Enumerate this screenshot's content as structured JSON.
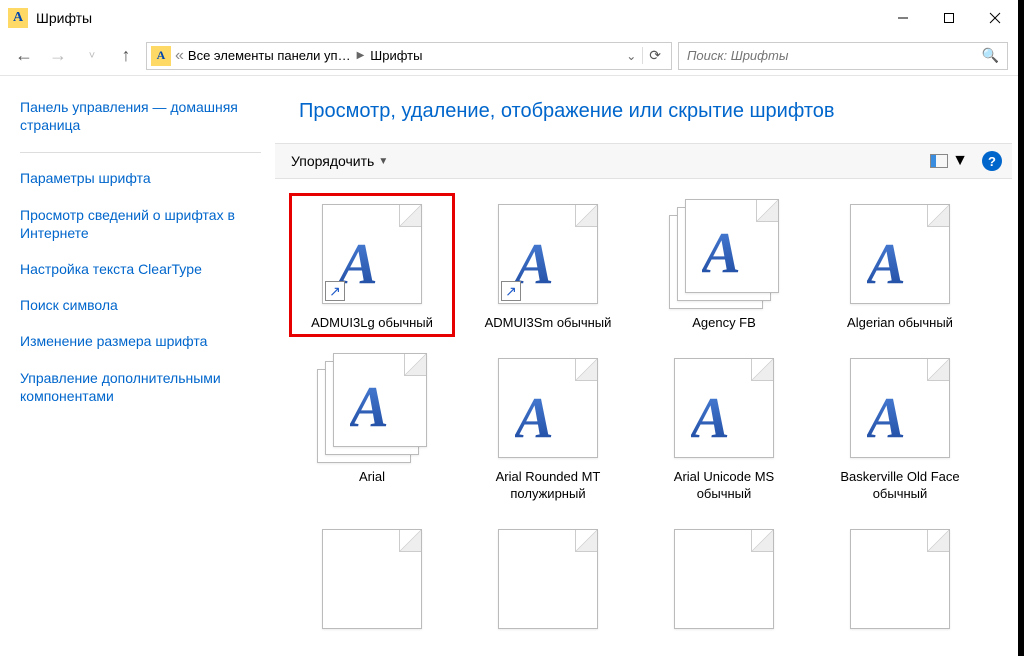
{
  "window": {
    "title": "Шрифты"
  },
  "address": {
    "seg1": "Все элементы панели уп…",
    "seg2": "Шрифты"
  },
  "search": {
    "placeholder": "Поиск: Шрифты"
  },
  "sidebar": {
    "home": "Панель управления — домашняя страница",
    "links": [
      "Параметры шрифта",
      "Просмотр сведений о шрифтах в Интернете",
      "Настройка текста ClearType",
      "Поиск символа",
      "Изменение размера шрифта",
      "Управление дополнительными компонентами"
    ]
  },
  "content": {
    "title": "Просмотр, удаление, отображение или скрытие шрифтов",
    "organize": "Упорядочить"
  },
  "fonts": [
    {
      "label": "ADMUI3Lg обычный",
      "stack": false,
      "shortcut": true,
      "selected": true
    },
    {
      "label": "ADMUI3Sm обычный",
      "stack": false,
      "shortcut": true,
      "selected": false
    },
    {
      "label": "Agency FB",
      "stack": true,
      "shortcut": false,
      "selected": false
    },
    {
      "label": "Algerian обычный",
      "stack": false,
      "shortcut": false,
      "selected": false
    },
    {
      "label": "Arial",
      "stack": true,
      "shortcut": false,
      "selected": false
    },
    {
      "label": "Arial Rounded MT полужирный",
      "stack": false,
      "shortcut": false,
      "selected": false
    },
    {
      "label": "Arial Unicode MS обычный",
      "stack": false,
      "shortcut": false,
      "selected": false
    },
    {
      "label": "Baskerville Old Face обычный",
      "stack": false,
      "shortcut": false,
      "selected": false
    }
  ]
}
